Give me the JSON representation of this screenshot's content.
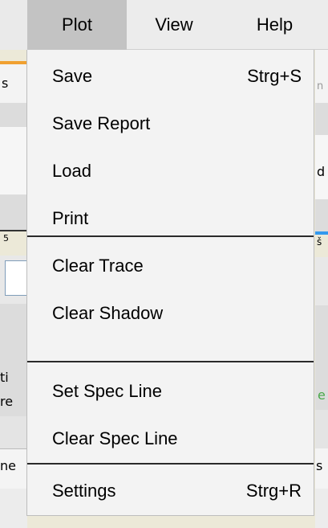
{
  "menubar": {
    "items": [
      {
        "label": "Plot"
      },
      {
        "label": "View"
      },
      {
        "label": "Help"
      }
    ]
  },
  "plot_menu": {
    "groups": [
      [
        {
          "label": "Save",
          "shortcut": "Strg+S"
        },
        {
          "label": "Save Report"
        },
        {
          "label": "Load"
        },
        {
          "label": "Print"
        }
      ],
      [
        {
          "label": "Clear Trace"
        },
        {
          "label": "Clear Shadow"
        }
      ],
      [
        {
          "label": "Set Spec Line"
        },
        {
          "label": "Clear Spec Line"
        }
      ],
      [
        {
          "label": "Settings",
          "shortcut": "Strg+R"
        }
      ]
    ]
  },
  "background_fragments": {
    "left": [
      "s",
      "5",
      "ti",
      "re",
      "ne"
    ],
    "right": [
      "n",
      "d",
      "š",
      "e",
      "s"
    ]
  },
  "colors": {
    "menubar_bg": "#ececec",
    "active_menu_bg": "#c3c3c3",
    "dropdown_bg": "#f3f3f3",
    "separator": "#2a2a2a",
    "accent_orange": "#f0a030",
    "accent_blue": "#3399ee"
  }
}
